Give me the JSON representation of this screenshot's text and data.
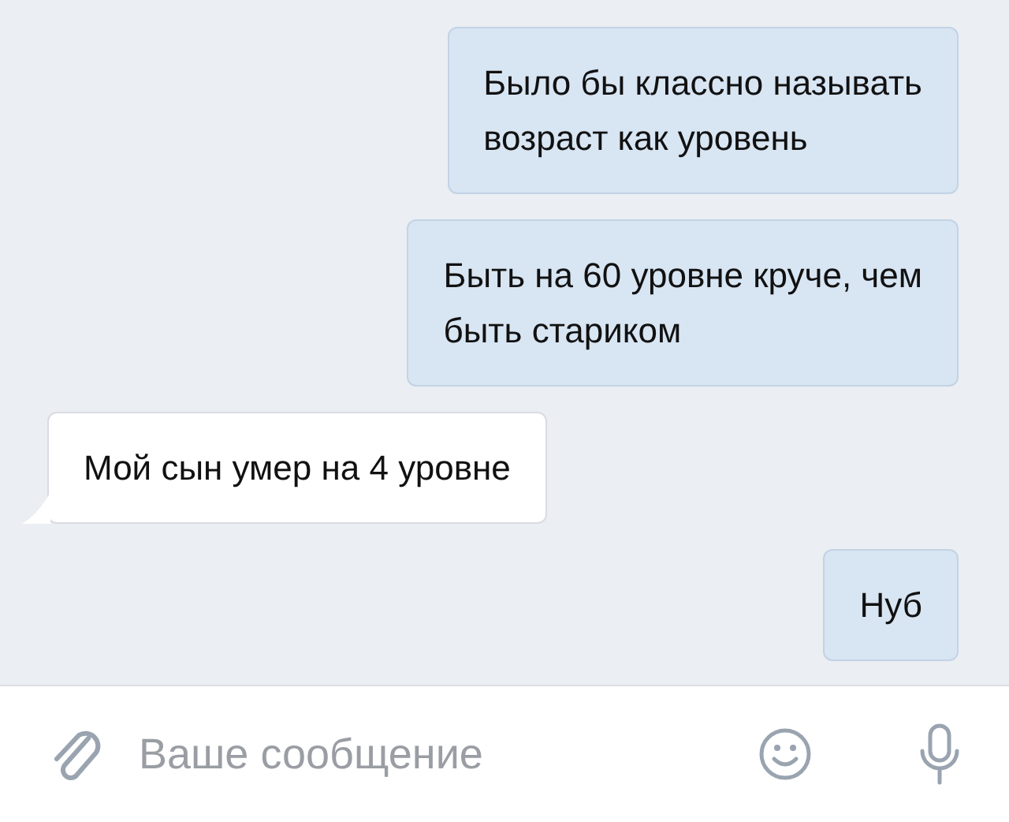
{
  "messages": [
    {
      "kind": "out",
      "text": "Было бы классно называть\nвозраст как уровень"
    },
    {
      "kind": "out",
      "text": "Быть на 60 уровне круче, чем\nбыть стариком"
    },
    {
      "kind": "in",
      "text": "Мой сын умер на 4 уровне"
    },
    {
      "kind": "out",
      "text": "Нуб"
    }
  ],
  "composer": {
    "placeholder": "Ваше сообщение"
  }
}
